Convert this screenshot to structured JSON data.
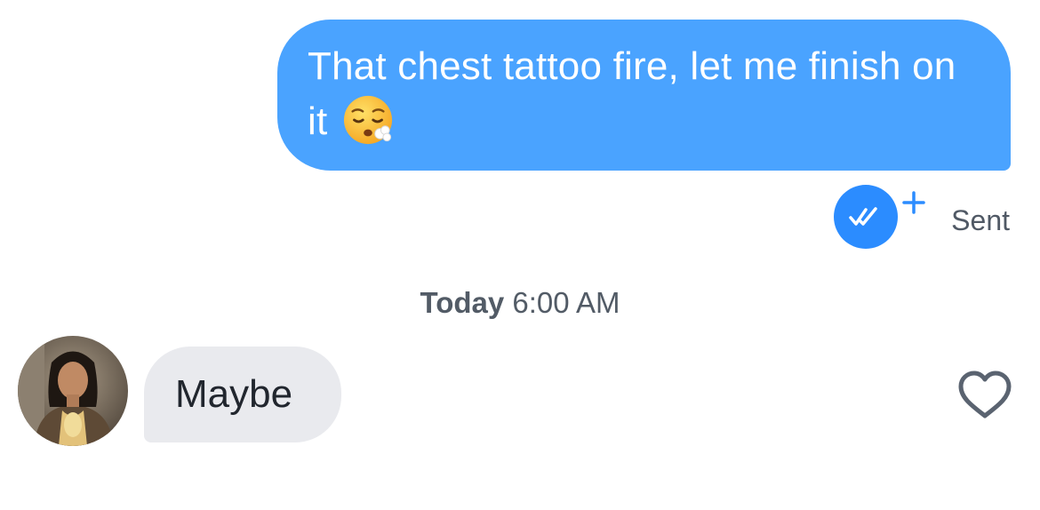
{
  "sent_message": {
    "text": "That chest tattoo fire, let me finish on it",
    "emoji": "face-exhaling",
    "status": "Sent",
    "bubble_color": "#4aa3ff"
  },
  "read_receipt": {
    "icon": "double-check-icon",
    "badge_icon": "plus-icon",
    "color": "#2b8cff"
  },
  "timestamp": {
    "day": "Today",
    "time": "6:00 AM"
  },
  "received_message": {
    "text": "Maybe",
    "bubble_color": "#e9eaee",
    "like_icon": "heart-outline-icon"
  }
}
